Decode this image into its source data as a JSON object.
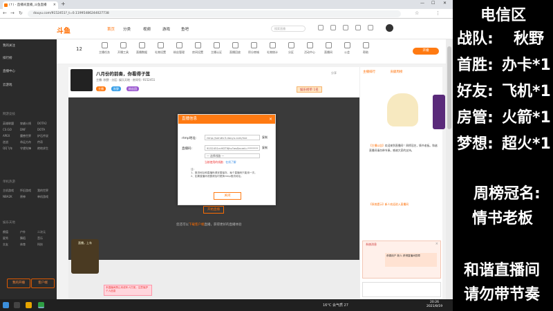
{
  "browser": {
    "tab_title": "(↑) - 直播间直播_斗鱼直播",
    "url": "douyu.com/9152451?_t=0.11995486244027738",
    "new_tab": "+"
  },
  "site": {
    "logo": "斗鱼",
    "nav": [
      "首页",
      "分类",
      "视频",
      "游戏",
      "鱼吧"
    ],
    "search_placeholder": "搜索直播",
    "live_button": "开播"
  },
  "sidebar": {
    "items": [
      "我的关注",
      "排行榜",
      "直播中心",
      "云游戏"
    ],
    "section1": "网游竞技",
    "cats1": [
      "英雄联盟",
      "穿越火线",
      "DOTA2",
      "CS:GO",
      "DNF",
      "DOTA",
      "APEX",
      "魔兽世界",
      "炉石传说",
      "逆战",
      "命运方舟",
      "传奇",
      "QQ飞车",
      "守望先锋",
      "绝地求生"
    ],
    "section2": "单机热游",
    "cats2": [
      "主机游戏",
      "怀旧游戏",
      "我的世界",
      "NBA2K",
      "原神",
      "单机游戏"
    ],
    "section3": "娱乐天地",
    "cats3": [
      "颜值",
      "户外",
      "二次元",
      "星秀",
      "舞蹈",
      "音乐",
      "交友",
      "体育",
      "科技"
    ],
    "btn_left": "我的开播",
    "btn_right": "客户端"
  },
  "catbar": {
    "level": "12",
    "items": [
      "主播任务",
      "开播工具",
      "直播数据",
      "礼物设置",
      "粉丝管理",
      "房间设置",
      "主播认证",
      "直播回放",
      "积分商城",
      "礼物统计",
      "分区",
      "活动中心",
      "直播间",
      "公会",
      "帮助"
    ]
  },
  "room": {
    "title": "八月份的前奏，你看得子莲",
    "meta": "主播: 秋野 · 分区: 娱乐天地 · 房间号: 9152451",
    "tags": [
      "主播",
      "秋野",
      "粉丝团"
    ],
    "rank_badge": "娱乐榜单 1名",
    "share": "分享"
  },
  "modal": {
    "title": "直播信息",
    "rtmp_label": "rtmp地址:",
    "rtmp_value": "rtmp://sendtc3.douyu.com/live",
    "rtmp_copy": "复制",
    "code_label": "直播码:",
    "code_value": "9152451rcHDT9Jhv?wsSecret=********",
    "code_copy": "复制",
    "select_value": "一 选择线路 一",
    "warning": "当前使用的线路：",
    "warning_link": "在线了解",
    "notes": [
      "注:",
      "1、推流地址和直播码请妥善保存，每个直播码只能用一次。",
      "2、如果直播码泄露请及时更换rtmp推流地址。"
    ],
    "close_button": "关闭",
    "close_icon": "×"
  },
  "player": {
    "start_button": "开始直播",
    "note": "您还可以",
    "note_link": "下载客户端",
    "note_tail": "直播，获得更好的直播体验"
  },
  "right": {
    "tabs": [
      "主播排行",
      "贡献周榜"
    ],
    "notice_head": "【主播公告】",
    "notice": "欢迎来到直播间！周榜冠名，情书老板。和谐直播间请勿带节奏，感谢大家的支持。",
    "chips": "【系统提示】新人欢迎进入直播间",
    "popup_title": "系统消息",
    "popup_body": "恭喜用户 新人 获得直播间勋章",
    "popup_close": "×"
  },
  "gift": {
    "label": "直播，上车"
  },
  "pink_note": "本直播间禁止未成年人打赏，注意保护个人信息",
  "taskbar": {
    "weather": "16°C 会气质 27",
    "time": "20:26",
    "date": "2021/8/19"
  },
  "overlay": {
    "region": "电信区",
    "team_label": "战队:",
    "team": "秋野",
    "firstwin_label": "首胜:",
    "firstwin": "办卡*1",
    "friend_label": "好友:",
    "friend": "飞机*1",
    "admin_label": "房管:",
    "admin": "火箭*1",
    "dream_label": "梦想:",
    "dream": "超火*1",
    "weekly_label": "周榜冠名:",
    "weekly": "情书老板",
    "rule1": "和谐直播间",
    "rule2": "请勿带节奏"
  }
}
